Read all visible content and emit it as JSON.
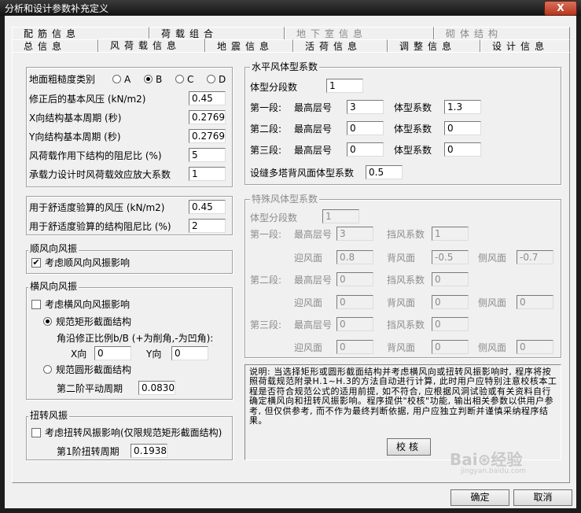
{
  "window": {
    "title": "分析和设计参数补充定义",
    "close_label": "X"
  },
  "tabs_row1": [
    "配筋信息",
    "荷载组合",
    "地下室信息",
    "砌体结构"
  ],
  "tabs_row2": [
    "总信息",
    "风荷载信息",
    "地震信息",
    "活荷信息",
    "调整信息",
    "设计信息"
  ],
  "basic": {
    "roughness_label": "地面粗糙度类别",
    "roughness_options": [
      "A",
      "B",
      "C",
      "D"
    ],
    "roughness_selected": "B",
    "rows": [
      {
        "label": "修正后的基本风压 (kN/m2)",
        "value": "0.45"
      },
      {
        "label": "X向结构基本周期 (秒)",
        "value": "0.27692"
      },
      {
        "label": "Y向结构基本周期 (秒)",
        "value": "0.27692"
      },
      {
        "label": "风荷载作用下结构的阻尼比 (%)",
        "value": "5"
      },
      {
        "label": "承载力设计时风荷载效应放大系数",
        "value": "1"
      }
    ]
  },
  "comfort": {
    "rows": [
      {
        "label": "用于舒适度验算的风压 (kN/m2)",
        "value": "0.45"
      },
      {
        "label": "用于舒适度验算的结构阻尼比 (%)",
        "value": "2"
      }
    ]
  },
  "along_wind": {
    "title": "顺风向风振",
    "check_label": "考虑顺风向风振影响",
    "checked": true
  },
  "cross_wind": {
    "title": "横风向风振",
    "check_label": "考虑横风向风振影响",
    "checked": false,
    "rect_label": "规范矩形截面结构",
    "corner_label": "角沿修正比例b/B (+为削角,-为凹角):",
    "x_label": "X向",
    "x_value": "0",
    "y_label": "Y向",
    "y_value": "0",
    "round_label": "规范圆形截面结构",
    "period_label": "第二阶平动周期",
    "period_value": "0.08307",
    "selected": "rect"
  },
  "torsion": {
    "title": "扭转风振",
    "check_label": "考虑扭转风振影响(仅限规范矩形截面结构)",
    "checked": false,
    "period_label": "第1阶扭转周期",
    "period_value": "0.19385"
  },
  "horizontal": {
    "title": "水平风体型系数",
    "segments_label": "体型分段数",
    "segments_value": "1",
    "rows": [
      {
        "label": "第一段:",
        "floor_label": "最高层号",
        "floor": "3",
        "coef_label": "体型系数",
        "coef": "1.3"
      },
      {
        "label": "第二段:",
        "floor_label": "最高层号",
        "floor": "0",
        "coef_label": "体型系数",
        "coef": "0"
      },
      {
        "label": "第三段:",
        "floor_label": "最高层号",
        "floor": "0",
        "coef_label": "体型系数",
        "coef": "0"
      }
    ],
    "multi_label": "设缝多塔背风面体型系数",
    "multi_value": "0.5"
  },
  "special": {
    "title": "特殊风体型系数",
    "segments_label": "体型分段数",
    "segments_value": "1",
    "floor_label": "最高层号",
    "shield_label": "挡风系数",
    "windward_label": "迎风面",
    "leeward_label": "背风面",
    "side_label": "侧风面",
    "rows": [
      {
        "label": "第一段:",
        "floor": "3",
        "shield": "1",
        "windward": "0.8",
        "leeward": "-0.5",
        "side": "-0.7"
      },
      {
        "label": "第二段:",
        "floor": "0",
        "shield": "0",
        "windward": "0",
        "leeward": "0",
        "side": "0"
      },
      {
        "label": "第三段:",
        "floor": "0",
        "shield": "0",
        "windward": "0",
        "leeward": "0",
        "side": "0"
      }
    ]
  },
  "note": {
    "text": "说明: 当选择矩形或圆形截面结构并考虑横风向或扭转风振影响时, 程序将按照荷载规范附录H.1~H.3的方法自动进行计算, 此时用户应特别注意校核本工程是否符合规范公式的适用前提, 如不符合, 应根据风洞试验或有关资料自行确定横风向和扭转风振影响。程序提供\"校核\"功能, 输出相关参数以供用户参考, 但仅供参考, 而不作为最终判断依据, 用户应独立判断并谨慎采纳程序结果。",
    "check_button": "校核"
  },
  "footer": {
    "ok": "确定",
    "cancel": "取消"
  },
  "watermark": {
    "logo": "Bai⊛经验",
    "url": "jingyan.baidu.com"
  }
}
